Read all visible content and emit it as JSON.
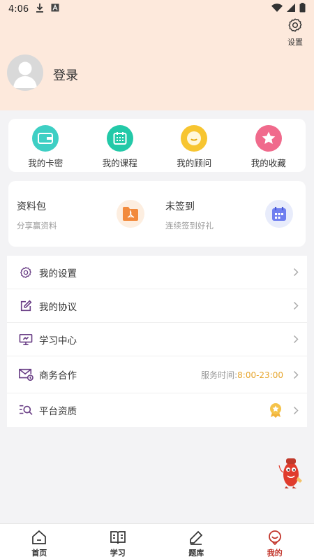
{
  "status_bar": {
    "time": "4:06"
  },
  "header": {
    "settings_label": "设置",
    "login_label": "登录"
  },
  "shortcuts": [
    {
      "label": "我的卡密",
      "icon": "card-icon",
      "color": "#3ecfc4"
    },
    {
      "label": "我的课程",
      "icon": "calendar-icon",
      "color": "#23c9a8"
    },
    {
      "label": "我的顾问",
      "icon": "advisor-icon",
      "color": "#f7c531"
    },
    {
      "label": "我的收藏",
      "icon": "star-icon",
      "color": "#f06a8c"
    }
  ],
  "promo": {
    "materials": {
      "title": "资料包",
      "subtitle": "分享赢资料"
    },
    "signin": {
      "title": "未签到",
      "subtitle": "连续签到好礼"
    }
  },
  "menu": {
    "settings": "我的设置",
    "agreement": "我的协议",
    "study_center": "学习中心",
    "business": "商务合作",
    "service_prefix": "服务时间:",
    "service_time": "8:00-23:00",
    "qualification": "平台资质"
  },
  "tabs": [
    {
      "label": "首页"
    },
    {
      "label": "学习"
    },
    {
      "label": "题库"
    },
    {
      "label": "我的"
    }
  ],
  "colors": {
    "accent": "#c2352b",
    "header_bg": "#fde9dc",
    "menu_icon": "#6a3f86",
    "service_time": "#e6a42a"
  }
}
